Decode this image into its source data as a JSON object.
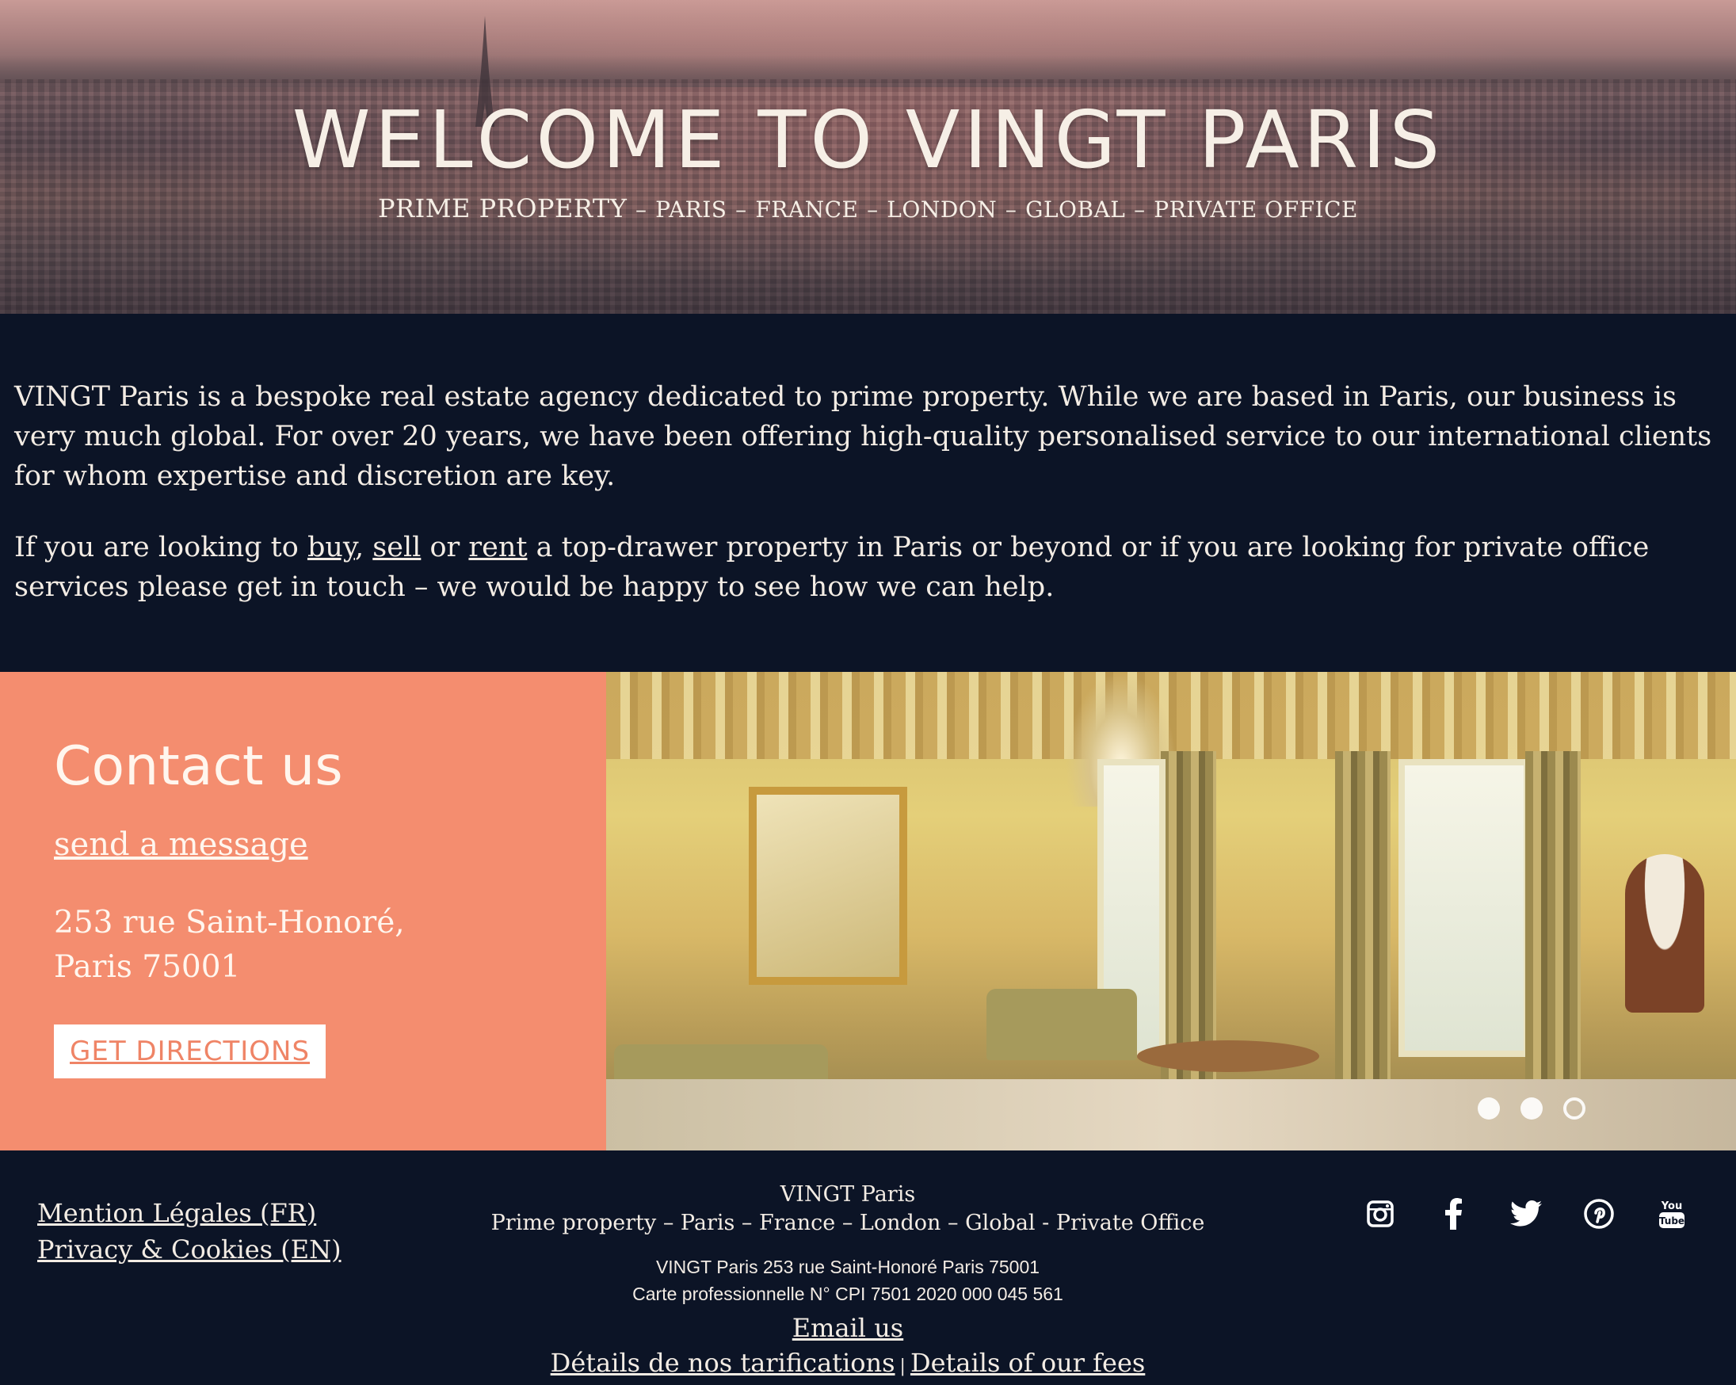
{
  "hero": {
    "title": "WELCOME TO VINGT PARIS",
    "subtitle_main": "PRIME PROPERTY",
    "subtitle_items": [
      "PARIS",
      "FRANCE",
      "LONDON",
      "GLOBAL",
      "PRIVATE OFFICE"
    ],
    "sep": "–"
  },
  "intro": {
    "p1": "VINGT Paris is a bespoke real estate agency dedicated to prime property. While we are based in Paris, our business is very much global. For over 20 years, we have been offering high-quality personalised service to our international clients for whom expertise and discretion are key.",
    "p2_before": "If you are looking to ",
    "buy": "buy",
    "comma": ", ",
    "sell": "sell",
    "or": " or ",
    "rent": "rent",
    "p2_after": " a top-drawer property in Paris or beyond or if you are looking for private office services please get in touch – we would be happy to see how we can help."
  },
  "contact": {
    "heading": "Contact us",
    "message_link": "send a message",
    "address_line1": "253 rue Saint-Honoré,",
    "address_line2": "Paris 75001",
    "directions_button": "GET DIRECTIONS"
  },
  "carousel": {
    "count": 3,
    "active_index": 2
  },
  "footer": {
    "legal_fr": "Mention Légales (FR)",
    "privacy_en": "Privacy & Cookies (EN)",
    "brand": "VINGT Paris",
    "tagline": "Prime property – Paris – France – London – Global - Private Office",
    "address": "VINGT Paris 253 rue Saint-Honoré Paris 75001",
    "license": "Carte professionnelle N° CPI 7501 2020 000 045 561",
    "email": "Email us",
    "fees_fr": "Détails de nos tarifications",
    "fees_sep": "|",
    "fees_en": "Details of our fees",
    "social": [
      "instagram-icon",
      "facebook-icon",
      "twitter-icon",
      "pinterest-icon",
      "youtube-icon"
    ]
  },
  "colors": {
    "navy": "#0c1426",
    "coral": "#f48d6f",
    "cream": "#f3ece4"
  }
}
